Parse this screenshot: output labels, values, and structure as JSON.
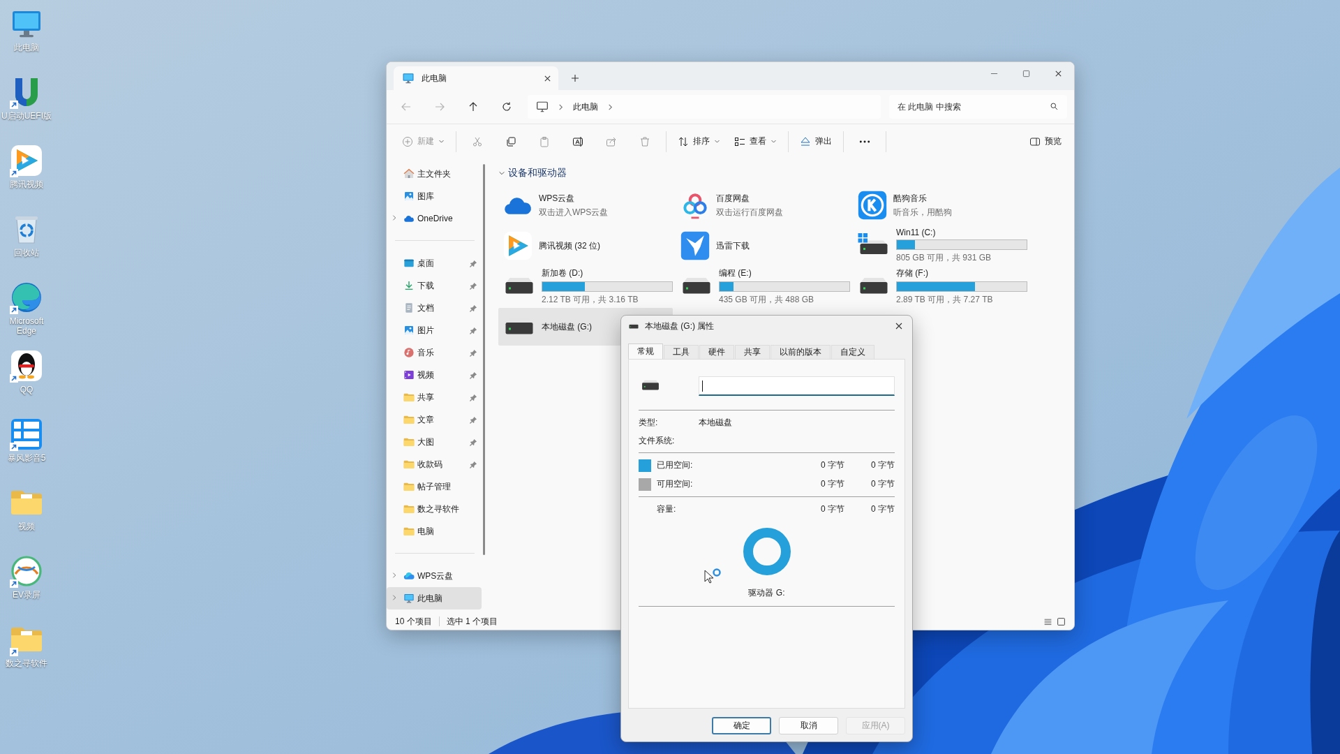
{
  "desktop_icons": [
    {
      "label": "此电脑",
      "kind": "monitor",
      "shortcut": false
    },
    {
      "label": "U启动UEFI版",
      "kind": "letter",
      "shortcut": true
    },
    {
      "label": "腾讯视频",
      "kind": "play",
      "shortcut": true
    },
    {
      "label": "回收站",
      "kind": "bin",
      "shortcut": false
    },
    {
      "label": "Microsoft Edge",
      "kind": "swirl",
      "shortcut": true
    },
    {
      "label": "QQ",
      "kind": "penguin",
      "shortcut": true
    },
    {
      "label": "暴风影音5",
      "kind": "tiles",
      "shortcut": true
    },
    {
      "label": "视频",
      "kind": "folder",
      "shortcut": false
    },
    {
      "label": "EV录屏",
      "kind": "ring",
      "shortcut": true
    },
    {
      "label": "数之寻软件",
      "kind": "folder",
      "shortcut": true
    }
  ],
  "explorer": {
    "tab": {
      "title": "此电脑"
    },
    "nav": [
      {
        "kind": "back",
        "disabled": true
      },
      {
        "kind": "forward",
        "disabled": true
      },
      {
        "kind": "up",
        "disabled": false
      },
      {
        "kind": "refresh",
        "disabled": false
      }
    ],
    "breadcrumb": [
      "此电脑"
    ],
    "search": {
      "placeholder": "在 此电脑 中搜索"
    },
    "toolbar_groups": [
      [
        {
          "kind": "new",
          "label": "新建",
          "disabled": true
        }
      ],
      [
        {
          "kind": "cut",
          "disabled": true
        },
        {
          "kind": "copy",
          "disabled": false
        },
        {
          "kind": "paste",
          "disabled": true
        },
        {
          "kind": "rename",
          "disabled": false
        },
        {
          "kind": "share",
          "disabled": true
        },
        {
          "kind": "delete",
          "disabled": true
        }
      ],
      [
        {
          "kind": "sort",
          "label": "排序",
          "disabled": false
        },
        {
          "kind": "view",
          "label": "查看",
          "disabled": false
        }
      ],
      [
        {
          "kind": "eject",
          "label": "弹出",
          "disabled": false
        }
      ],
      [
        {
          "kind": "more",
          "disabled": false
        }
      ]
    ],
    "preview_button": {
      "label": "预览"
    },
    "sidebar": {
      "groups": [
        [
          {
            "label": "主文件夹",
            "kind": "home",
            "pinned": false,
            "selected": false
          },
          {
            "label": "图库",
            "kind": "gallery",
            "pinned": false,
            "selected": false
          },
          {
            "label": "OneDrive",
            "kind": "cloud",
            "pinned": false,
            "selected": false,
            "expanded": false
          }
        ],
        [
          {
            "label": "桌面",
            "kind": "desktop",
            "pinned": true,
            "selected": false
          },
          {
            "label": "下载",
            "kind": "download",
            "pinned": true,
            "selected": false
          },
          {
            "label": "文档",
            "kind": "document",
            "pinned": true,
            "selected": false
          },
          {
            "label": "图片",
            "kind": "gallery",
            "pinned": true,
            "selected": false
          },
          {
            "label": "音乐",
            "kind": "music",
            "pinned": true,
            "selected": false
          },
          {
            "label": "视频",
            "kind": "video",
            "pinned": true,
            "selected": false
          },
          {
            "label": "共享",
            "kind": "folder",
            "pinned": true,
            "selected": false
          },
          {
            "label": "文章",
            "kind": "folder",
            "pinned": true,
            "selected": false
          },
          {
            "label": "大图",
            "kind": "folder",
            "pinned": true,
            "selected": false
          },
          {
            "label": "收款码",
            "kind": "folder",
            "pinned": true,
            "selected": false
          },
          {
            "label": "帖子管理",
            "kind": "folder",
            "pinned": false,
            "selected": false
          },
          {
            "label": "数之寻软件",
            "kind": "folder",
            "pinned": false,
            "selected": false
          },
          {
            "label": "电脑",
            "kind": "folder",
            "pinned": false,
            "selected": false
          }
        ],
        [
          {
            "label": "WPS云盘",
            "kind": "cloud2",
            "pinned": false,
            "selected": false,
            "expanded": false
          },
          {
            "label": "此电脑",
            "kind": "monitor",
            "pinned": false,
            "selected": true,
            "expanded": false
          }
        ]
      ]
    },
    "section": {
      "title": "设备和驱动器",
      "expanded": true,
      "items": [
        {
          "kind": "cloud",
          "title": "WPS云盘",
          "subtitle": "双击进入WPS云盘",
          "selected": false
        },
        {
          "kind": "rings",
          "title": "百度网盘",
          "subtitle": "双击运行百度网盘",
          "selected": false
        },
        {
          "kind": "badge",
          "title": "酷狗音乐",
          "subtitle": "听音乐，用酷狗",
          "selected": false
        },
        {
          "kind": "play",
          "title": "腾讯视频 (32 位)",
          "selected": false
        },
        {
          "kind": "bird",
          "title": "迅雷下载",
          "selected": false
        },
        {
          "kind": "sysdrive",
          "title": "Win11 (C:)",
          "level": 0.14,
          "free": "805 GB 可用，共 931 GB",
          "selected": false
        },
        {
          "kind": "drive",
          "title": "新加卷 (D:)",
          "level": 0.33,
          "free": "2.12 TB 可用，共 3.16 TB",
          "selected": false
        },
        {
          "kind": "drive",
          "title": "编程 (E:)",
          "level": 0.11,
          "free": "435 GB 可用，共 488 GB",
          "selected": false
        },
        {
          "kind": "drive",
          "title": "存储 (F:)",
          "level": 0.6,
          "free": "2.89 TB 可用，共 7.27 TB",
          "selected": false
        },
        {
          "kind": "drive",
          "title": "本地磁盘 (G:)",
          "selected": true
        }
      ]
    },
    "status_bar": {
      "count": "10 个项目",
      "selection": "选中 1 个项目"
    }
  },
  "dialog": {
    "title": "本地磁盘 (G:) 属性",
    "tabs": [
      {
        "label": "常规",
        "selected": true
      },
      {
        "label": "工具",
        "selected": false
      },
      {
        "label": "硬件",
        "selected": false
      },
      {
        "label": "共享",
        "selected": false
      },
      {
        "label": "以前的版本",
        "selected": false
      },
      {
        "label": "自定义",
        "selected": false
      }
    ],
    "name_field": {
      "focused": true
    },
    "type_label": "类型:",
    "type_value": "本地磁盘",
    "fs_label": "文件系统:",
    "space_rows": [
      {
        "label": "已用空间:",
        "color": "#26a0da",
        "bytes": "0 字节",
        "size": "0 字节"
      },
      {
        "label": "可用空间:",
        "color": "#a8a8a8",
        "bytes": "0 字节",
        "size": "0 字节"
      }
    ],
    "capacity": {
      "label": "容量:",
      "bytes": "0 字节",
      "size": "0 字节"
    },
    "drive_label": "驱动器 G:",
    "buttons": [
      {
        "label": "确定",
        "kind": "default",
        "disabled": false
      },
      {
        "label": "取消",
        "kind": "normal",
        "disabled": false
      },
      {
        "label": "应用(A)",
        "kind": "normal",
        "disabled": true
      }
    ]
  }
}
